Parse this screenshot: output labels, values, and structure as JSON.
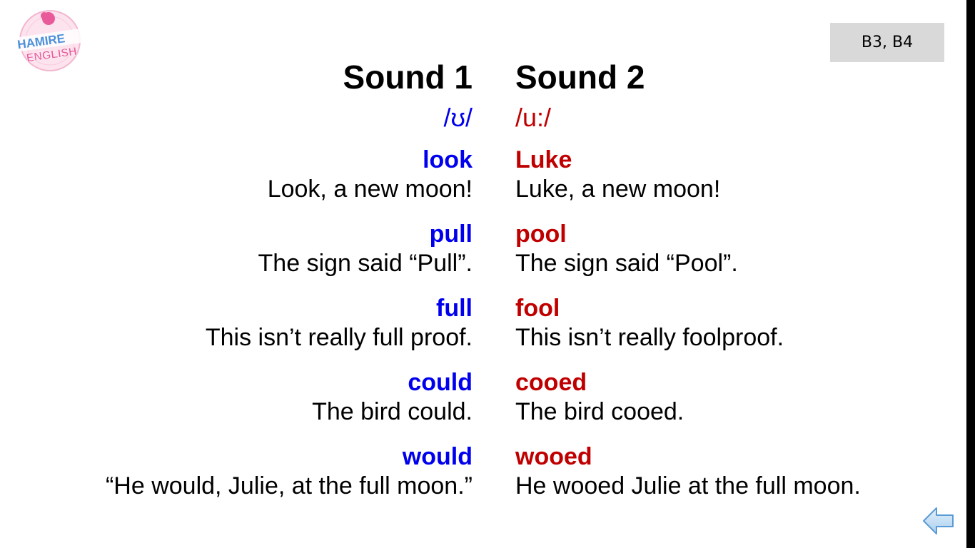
{
  "logo": {
    "text": "HAMIRE ENGLISH"
  },
  "badge": {
    "label": "B3, B4"
  },
  "columns": {
    "left": {
      "heading": "Sound 1",
      "ipa": "/ʊ/",
      "pairs": [
        {
          "word": "look",
          "sentence": "Look, a new moon!"
        },
        {
          "word": "pull",
          "sentence": "The sign said “Pull”."
        },
        {
          "word": "full",
          "sentence": "This isn’t really full proof."
        },
        {
          "word": "could",
          "sentence": "The bird could."
        },
        {
          "word": "would",
          "sentence": "“He would, Julie, at the full moon.”"
        }
      ]
    },
    "right": {
      "heading": "Sound 2",
      "ipa": "/u:/",
      "pairs": [
        {
          "word": "Luke",
          "sentence": "Luke, a new moon!"
        },
        {
          "word": "pool",
          "sentence": "The sign said “Pool”."
        },
        {
          "word": "fool",
          "sentence": "This isn’t really foolproof."
        },
        {
          "word": "cooed",
          "sentence": "The bird cooed."
        },
        {
          "word": "wooed",
          "sentence": "He wooed Julie at the full moon."
        }
      ]
    }
  },
  "colors": {
    "sound1": "#0000ee",
    "sound2": "#c00000",
    "badge_bg": "#d9d9d9",
    "arrow_fill": "#c5e0f5",
    "arrow_stroke": "#5b9bd5"
  },
  "navigation": {
    "back_icon": "back-arrow-icon"
  }
}
